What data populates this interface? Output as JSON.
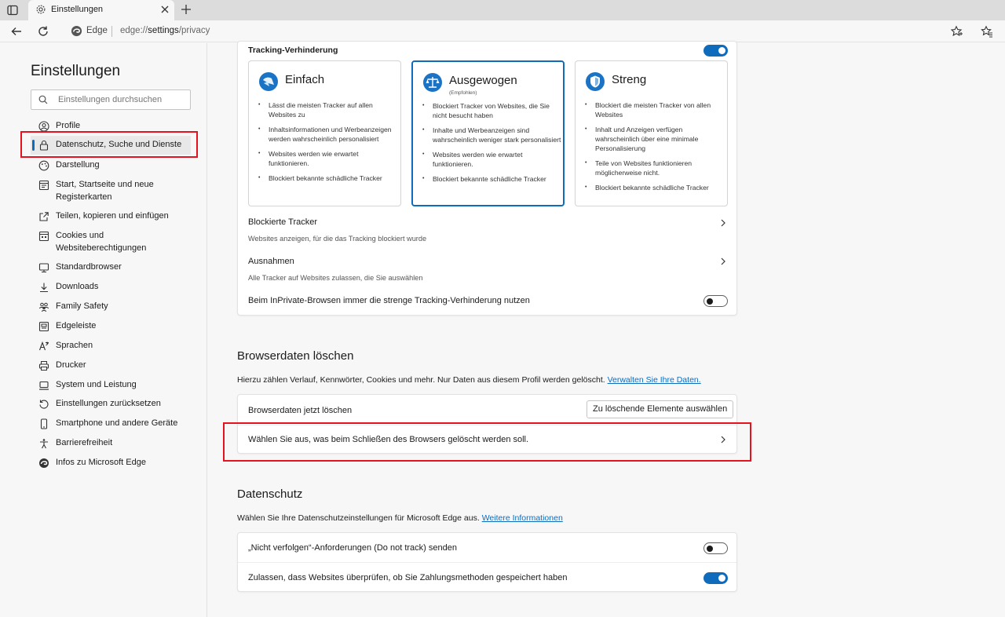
{
  "browser": {
    "tab_title": "Einstellungen",
    "address_label": "Edge",
    "url_prefix": "edge://",
    "url_bold": "settings",
    "url_suffix": "/privacy"
  },
  "sidebar": {
    "title": "Einstellungen",
    "search_placeholder": "Einstellungen durchsuchen",
    "items": [
      {
        "label": "Profile",
        "icon": "profile-icon"
      },
      {
        "label": "Datenschutz, Suche und Dienste",
        "icon": "lock-icon"
      },
      {
        "label": "Darstellung",
        "icon": "appearance-icon"
      },
      {
        "label": "Start, Startseite und neue Registerkarten",
        "icon": "start-page-icon"
      },
      {
        "label": "Teilen, kopieren und einfügen",
        "icon": "share-icon"
      },
      {
        "label": "Cookies und Websiteberechtigungen",
        "icon": "cookies-icon"
      },
      {
        "label": "Standardbrowser",
        "icon": "default-browser-icon"
      },
      {
        "label": "Downloads",
        "icon": "download-icon"
      },
      {
        "label": "Family Safety",
        "icon": "family-icon"
      },
      {
        "label": "Edgeleiste",
        "icon": "edge-bar-icon"
      },
      {
        "label": "Sprachen",
        "icon": "language-icon"
      },
      {
        "label": "Drucker",
        "icon": "printer-icon"
      },
      {
        "label": "System und Leistung",
        "icon": "system-icon"
      },
      {
        "label": "Einstellungen zurücksetzen",
        "icon": "reset-icon"
      },
      {
        "label": "Smartphone und andere Geräte",
        "icon": "phone-icon"
      },
      {
        "label": "Barrierefreiheit",
        "icon": "accessibility-icon"
      },
      {
        "label": "Infos zu Microsoft Edge",
        "icon": "edge-logo-icon"
      }
    ]
  },
  "tracking": {
    "title": "Tracking-Verhinderung",
    "enabled": true,
    "levels": [
      {
        "title": "Einfach",
        "subtitle": "",
        "selected": false,
        "bullets": [
          "Lässt die meisten Tracker auf allen Websites zu",
          "Inhaltsinformationen und Werbeanzeigen werden wahrscheinlich personalisiert",
          "Websites werden wie erwartet funktionieren.",
          "Blockiert bekannte schädliche Tracker"
        ]
      },
      {
        "title": "Ausgewogen",
        "subtitle": "(Empfohlen)",
        "selected": true,
        "bullets": [
          "Blockiert Tracker von Websites, die Sie nicht besucht haben",
          "Inhalte und Werbeanzeigen sind wahrscheinlich weniger stark personalisiert",
          "Websites werden wie erwartet funktionieren.",
          "Blockiert bekannte schädliche Tracker"
        ]
      },
      {
        "title": "Streng",
        "subtitle": "",
        "selected": false,
        "bullets": [
          "Blockiert die meisten Tracker von allen Websites",
          "Inhalt und Anzeigen verfügen wahrscheinlich über eine minimale Personalisierung",
          "Teile von Websites funktionieren möglicherweise nicht.",
          "Blockiert bekannte schädliche Tracker"
        ]
      }
    ],
    "blocked_title": "Blockierte Tracker",
    "blocked_desc": "Websites anzeigen, für die das Tracking blockiert wurde",
    "exceptions_title": "Ausnahmen",
    "exceptions_desc": "Alle Tracker auf Websites zulassen, die Sie auswählen",
    "inprivate_label": "Beim InPrivate-Browsen immer die strenge Tracking-Verhinderung nutzen",
    "inprivate_enabled": false
  },
  "clear_data": {
    "title": "Browserdaten löschen",
    "desc": "Hierzu zählen Verlauf, Kennwörter, Cookies und mehr. Nur Daten aus diesem Profil werden gelöscht.",
    "link": "Verwalten Sie Ihre Daten.",
    "now_label": "Browserdaten jetzt löschen",
    "choose_button": "Zu löschende Elemente auswählen",
    "on_close_label": "Wählen Sie aus, was beim Schließen des Browsers gelöscht werden soll."
  },
  "privacy": {
    "title": "Datenschutz",
    "desc": "Wählen Sie Ihre Datenschutzeinstellungen für Microsoft Edge aus.",
    "link": "Weitere Informationen",
    "dnt_label": "„Nicht verfolgen“-Anforderungen (Do not track) senden",
    "dnt_enabled": false,
    "payment_label": "Zulassen, dass Websites überprüfen, ob Sie Zahlungsmethoden gespeichert haben",
    "payment_enabled": true
  },
  "colors": {
    "accent": "#0f6cbd",
    "highlight": "#e5121f"
  }
}
